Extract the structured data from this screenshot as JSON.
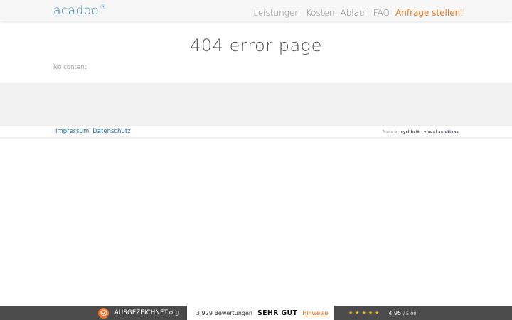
{
  "header": {
    "logo": "acadoo",
    "logo_mark": "®",
    "nav": [
      "Leistungen",
      "Kosten",
      "Ablauf",
      "FAQ"
    ],
    "cta": "Anfrage stellen!"
  },
  "main": {
    "title": "404 error page",
    "body_text": "No content"
  },
  "footer": {
    "links": [
      "Impressum",
      "Datenschutz"
    ],
    "made_by_prefix": "Made by",
    "made_by_name": "cyclikeit - visual solutions"
  },
  "review_badge": {
    "brand": "AUSGEZEICHNET.org",
    "review_count": "3.929 Bewertungen",
    "grade": "SEHR GUT",
    "hint_link": "Hinweise",
    "star_count": 5,
    "score": "4.95",
    "score_max": "/ 5.00",
    "colors": {
      "accent": "#e87e2b",
      "star": "#f0b323",
      "bar": "#4b4b4b"
    },
    "icon": "checkmark-seal-icon"
  }
}
